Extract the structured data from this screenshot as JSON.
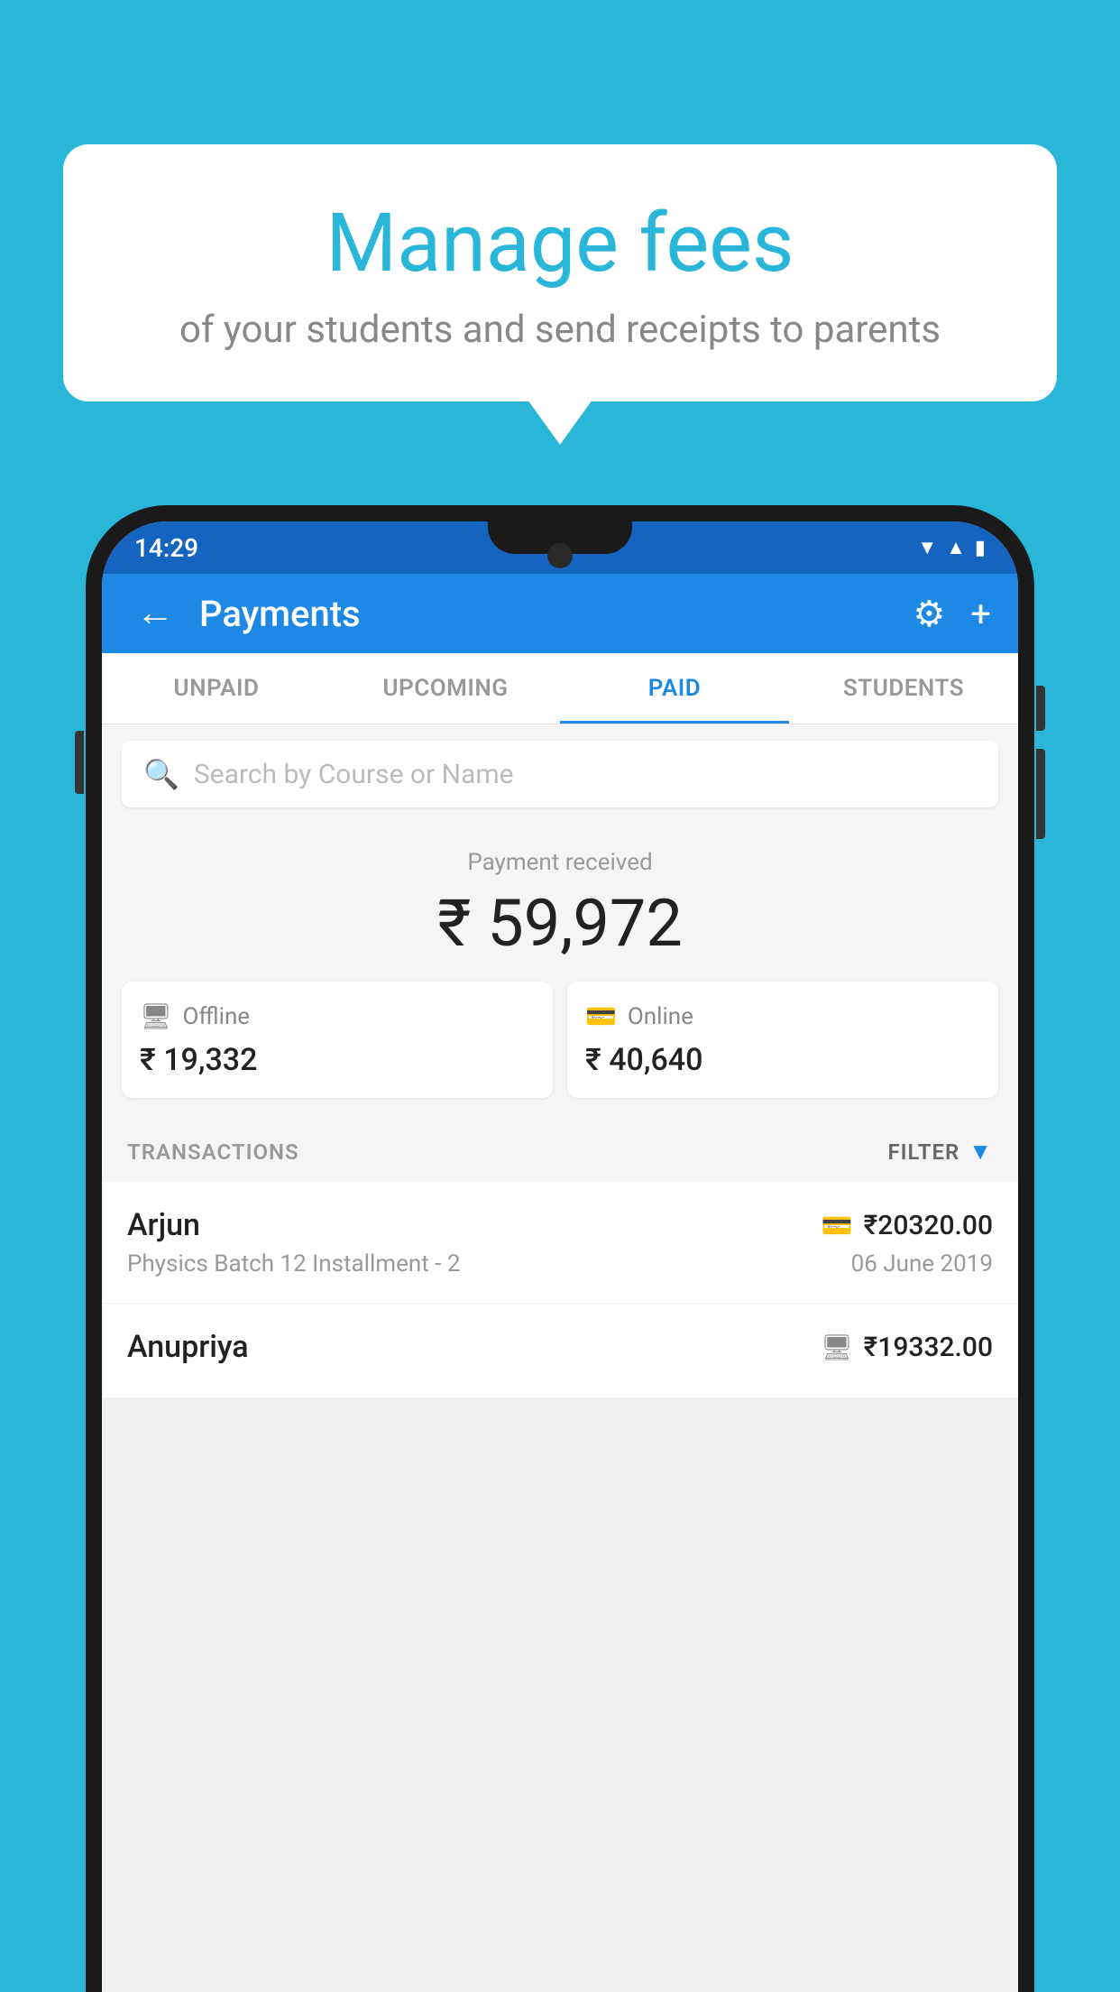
{
  "background_color": "#29B6D8",
  "speech_bubble": {
    "title": "Manage fees",
    "subtitle": "of your students and send receipts to parents"
  },
  "status_bar": {
    "time": "14:29",
    "icons": [
      "wifi",
      "signal",
      "battery"
    ]
  },
  "app_bar": {
    "title": "Payments",
    "back_label": "←",
    "gear_label": "⚙",
    "plus_label": "+"
  },
  "tabs": [
    {
      "id": "unpaid",
      "label": "UNPAID",
      "active": false
    },
    {
      "id": "upcoming",
      "label": "UPCOMING",
      "active": false
    },
    {
      "id": "paid",
      "label": "PAID",
      "active": true
    },
    {
      "id": "students",
      "label": "STUDENTS",
      "active": false
    }
  ],
  "search": {
    "placeholder": "Search by Course or Name"
  },
  "payment_summary": {
    "label": "Payment received",
    "total": "₹ 59,972",
    "offline": {
      "label": "Offline",
      "amount": "₹ 19,332"
    },
    "online": {
      "label": "Online",
      "amount": "₹ 40,640"
    }
  },
  "transactions": {
    "header_label": "TRANSACTIONS",
    "filter_label": "FILTER",
    "items": [
      {
        "name": "Arjun",
        "amount": "₹20320.00",
        "mode": "online",
        "description": "Physics Batch 12 Installment - 2",
        "date": "06 June 2019"
      },
      {
        "name": "Anupriya",
        "amount": "₹19332.00",
        "mode": "offline",
        "description": "",
        "date": ""
      }
    ]
  }
}
